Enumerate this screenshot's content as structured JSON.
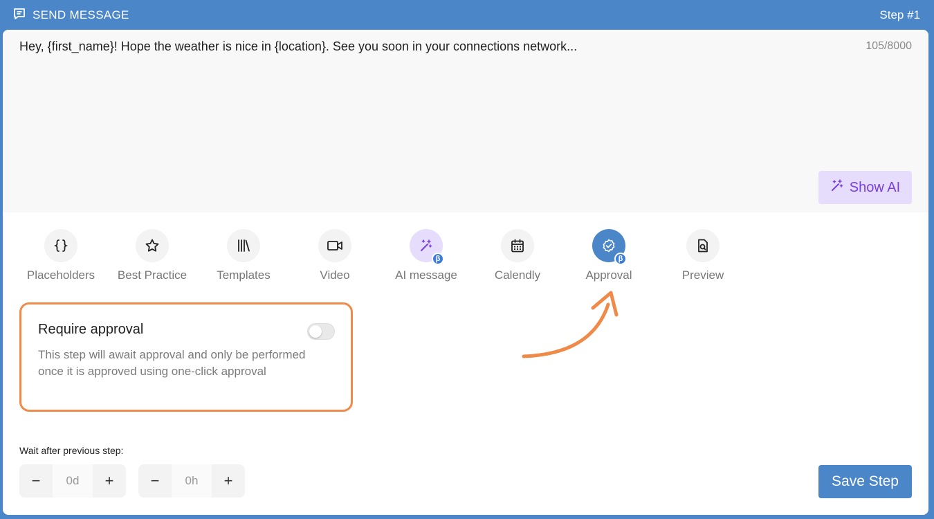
{
  "header": {
    "title": "SEND MESSAGE",
    "step": "Step #1"
  },
  "editor": {
    "message": "Hey, {first_name}! Hope the weather is nice in {location}. See you soon in your connections network...",
    "char_count": "105/8000",
    "show_ai_label": "Show AI"
  },
  "tools": [
    {
      "label": "Placeholders",
      "icon": "braces-icon"
    },
    {
      "label": "Best Practice",
      "icon": "star-icon"
    },
    {
      "label": "Templates",
      "icon": "library-icon"
    },
    {
      "label": "Video",
      "icon": "video-camera-icon"
    },
    {
      "label": "AI message",
      "icon": "magic-wand-icon",
      "beta": "β"
    },
    {
      "label": "Calendly",
      "icon": "calendar-icon"
    },
    {
      "label": "Approval",
      "icon": "check-badge-icon",
      "beta": "β"
    },
    {
      "label": "Preview",
      "icon": "file-search-icon"
    }
  ],
  "approval": {
    "title": "Require approval",
    "description": "This step will await approval and only be performed once it is approved using one-click approval",
    "toggle_on": false
  },
  "wait": {
    "label": "Wait after previous step:",
    "days": "0d",
    "hours": "0h",
    "minus": "−",
    "plus": "+"
  },
  "save_label": "Save Step",
  "colors": {
    "header_blue": "#4a86c8",
    "ai_purple": "#7a3fe0",
    "ai_bg": "#e6dcfb",
    "highlight_orange": "#ef8a48",
    "beta_blue": "#3d7fd8"
  }
}
